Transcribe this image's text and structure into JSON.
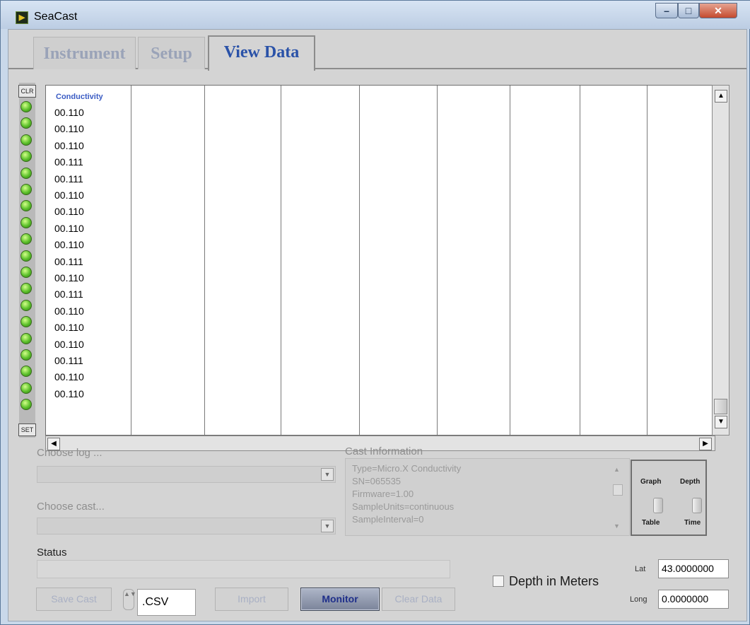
{
  "window": {
    "title": "SeaCast",
    "min_glyph": "–",
    "max_glyph": "□",
    "close_glyph": "✕",
    "app_icon_glyph": "▶"
  },
  "tabs": [
    {
      "label": "Instrument"
    },
    {
      "label": "Setup"
    },
    {
      "label": "View Data",
      "active": true
    }
  ],
  "table": {
    "clr_label": "CLR",
    "set_label": "SET",
    "column_header": "Conductivity",
    "values": [
      "00.110",
      "00.110",
      "00.110",
      "00.111",
      "00.111",
      "00.110",
      "00.110",
      "00.110",
      "00.110",
      "00.111",
      "00.110",
      "00.111",
      "00.110",
      "00.110",
      "00.110",
      "00.111",
      "00.110",
      "00.110"
    ],
    "led_count": 19,
    "column_boundaries_count": 9,
    "scroll_up": "▲",
    "scroll_down": "▼",
    "scroll_left": "◀",
    "scroll_right": "▶"
  },
  "log": {
    "label": "Choose log ...",
    "value": ""
  },
  "cast": {
    "label": "Choose cast...",
    "value": ""
  },
  "cast_info": {
    "label": "Cast Information",
    "lines": [
      "Type=Micro.X Conductivity",
      "SN=065535",
      "Firmware=1.00",
      "SampleUnits=continuous",
      "SampleInterval=0"
    ]
  },
  "switches": {
    "graph": "Graph",
    "table": "Table",
    "depth": "Depth",
    "time": "Time"
  },
  "status": {
    "label": "Status",
    "text": ""
  },
  "buttons": {
    "save_cast": "Save Cast",
    "import": "Import",
    "monitor": "Monitor",
    "clear_data": "Clear Data"
  },
  "extension": {
    "value": ".CSV",
    "stepper_glyph": "▲▼"
  },
  "depth_in_meters": {
    "label": "Depth in Meters",
    "checked": false
  },
  "coords": {
    "lat_label": "Lat",
    "lat": "43.0000000",
    "long_label": "Long",
    "long": "0.0000000"
  },
  "colors": {
    "tab_active": "#2a52a8",
    "header_blue": "#3b5cc4",
    "led_green": "#5bc02a",
    "monitor_text": "#1f2f8a"
  }
}
